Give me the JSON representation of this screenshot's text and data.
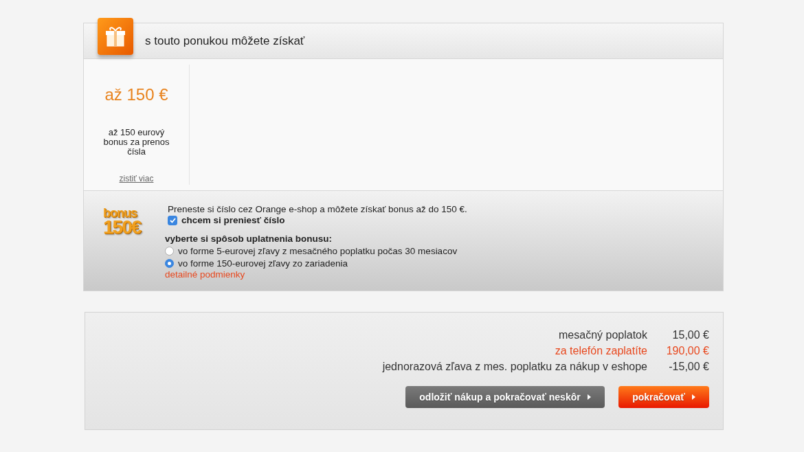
{
  "offer": {
    "title": "s touto ponukou môžete získať",
    "items": [
      {
        "amount": "až 150 €",
        "description": "až 150 eurový bonus za prenos čísla",
        "link": "zistiť viac"
      }
    ]
  },
  "bonus": {
    "badge_top": "bonus",
    "badge_bottom": "150€",
    "intro": "Preneste si číslo cez Orange e-shop a môžete získať bonus až do 150 €.",
    "transfer": {
      "label": "chcem si preniesť číslo",
      "checked": true
    },
    "method_heading": "vyberte si spôsob uplatnenia bonusu:",
    "options": [
      {
        "label": "vo forme 5-eurovej zľavy z mesačného poplatku počas 30 mesiacov",
        "selected": false
      },
      {
        "label": "vo forme 150-eurovej zľavy zo zariadenia",
        "selected": true
      }
    ],
    "terms_link": "detailné podmienky"
  },
  "summary": {
    "rows": [
      {
        "label": "mesačný poplatok",
        "value": "15,00 €",
        "kind": "normal"
      },
      {
        "label": "za telefón zaplatíte",
        "value": "190,00 €",
        "kind": "highlight"
      },
      {
        "label": "jednorazová zľava z mes. poplatku za nákup v eshope",
        "value": "-15,00 €",
        "kind": "normal"
      }
    ],
    "buttons": [
      {
        "label": "odložiť nákup a pokračovať neskôr",
        "kind": "secondary"
      },
      {
        "label": "pokračovať",
        "kind": "primary"
      }
    ]
  }
}
